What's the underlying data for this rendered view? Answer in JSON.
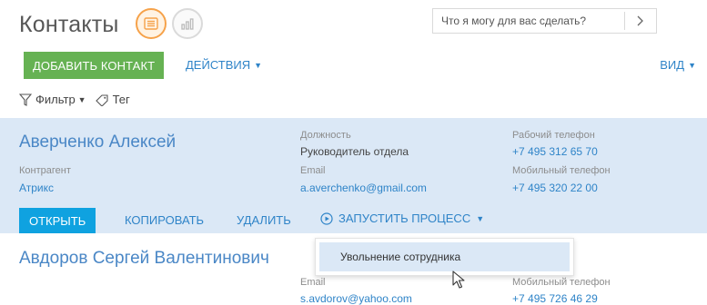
{
  "header": {
    "title": "Контакты",
    "search_placeholder": "Что я могу для вас сделать?"
  },
  "toolbar": {
    "add_label": "ДОБАВИТЬ КОНТАКТ",
    "actions_label": "ДЕЙСТВИЯ",
    "view_label": "ВИД"
  },
  "filters": {
    "filter_label": "Фильтр",
    "tag_label": "Тег"
  },
  "records": [
    {
      "name": "Аверченко Алексей",
      "account_label": "Контрагент",
      "account_value": "Атрикс",
      "job_label": "Должность",
      "job_value": "Руководитель отдела",
      "email_label": "Email",
      "email_value": "a.averchenko@gmail.com",
      "work_phone_label": "Рабочий телефон",
      "work_phone_value": "+7 495 312 65 70",
      "mobile_label": "Мобильный телефон",
      "mobile_value": "+7 495 320 22 00"
    },
    {
      "name": "Авдоров Сергей Валентинович",
      "email_label": "Email",
      "email_value": "s.avdorov@yahoo.com",
      "mobile_label": "Мобильный телефон",
      "mobile_value": "+7 495 726 46 29"
    }
  ],
  "record_actions": {
    "open": "ОТКРЫТЬ",
    "copy": "КОПИРОВАТЬ",
    "delete": "УДАЛИТЬ",
    "run_process": "ЗАПУСТИТЬ ПРОЦЕСС"
  },
  "process_menu": {
    "items": [
      "Увольнение сотрудника"
    ]
  },
  "colors": {
    "accent_blue": "#2f84c8",
    "add_green": "#66b253",
    "open_blue": "#0fa2e0",
    "selected_row": "#dbe8f6",
    "active_toggle": "#f6a24a"
  }
}
